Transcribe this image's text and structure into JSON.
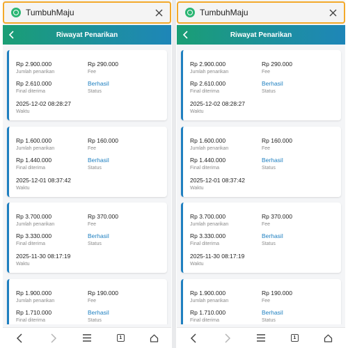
{
  "browser": {
    "site_title": "TumbuhMaju"
  },
  "header": {
    "title": "Riwayat Penarikan"
  },
  "labels": {
    "amount": "Jumlah penarikan",
    "fee": "Fee",
    "final": "Final diterima",
    "status": "Status",
    "time": "Waktu"
  },
  "withdrawals": [
    {
      "amount": "Rp 2.900.000",
      "fee": "Rp 290.000",
      "final": "Rp 2.610.000",
      "status": "Berhasil",
      "time": "2025-12-02 08:28:27"
    },
    {
      "amount": "Rp 1.600.000",
      "fee": "Rp 160.000",
      "final": "Rp 1.440.000",
      "status": "Berhasil",
      "time": "2025-12-01 08:37:42"
    },
    {
      "amount": "Rp 3.700.000",
      "fee": "Rp 370.000",
      "final": "Rp 3.330.000",
      "status": "Berhasil",
      "time": "2025-11-30 08:17:19"
    },
    {
      "amount": "Rp 1.900.000",
      "fee": "Rp 190.000",
      "final": "Rp 1.710.000",
      "status": "Berhasil",
      "time": ""
    }
  ],
  "nav": {
    "tab_count": "1"
  },
  "colors": {
    "header_start": "#1a9e74",
    "header_end": "#1e86b8",
    "status_text": "#1e7fc0",
    "card_accent": "#1e7fc0",
    "url_bar_border": "#f3a92a",
    "site_logo": "#2bb673"
  },
  "icons": {
    "browser": [
      "site-logo-icon",
      "close-icon"
    ],
    "header": [
      "back-arrow-icon"
    ],
    "nav": [
      "back-icon",
      "forward-icon",
      "menu-icon",
      "tabs-icon",
      "home-icon"
    ]
  }
}
